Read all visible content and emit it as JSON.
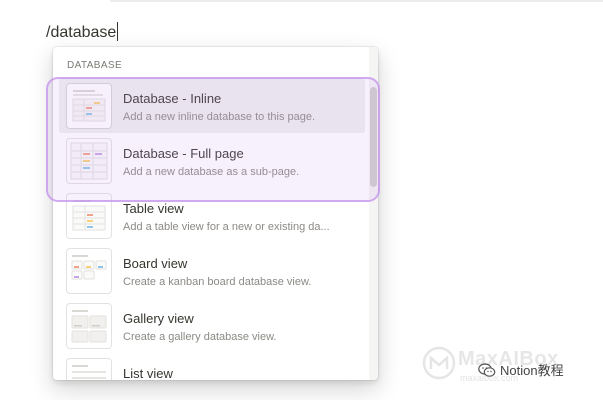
{
  "command": {
    "text": "/database"
  },
  "menu": {
    "header": "DATABASE",
    "items": [
      {
        "title": "Database - Inline",
        "description": "Add a new inline database to this page.",
        "icon": "database-inline-thumbnail-icon",
        "active": true
      },
      {
        "title": "Database - Full page",
        "description": "Add a new database as a sub-page.",
        "icon": "database-full-page-thumbnail-icon",
        "active": false
      },
      {
        "title": "Table view",
        "description": "Add a table view for a new or existing da...",
        "icon": "table-view-thumbnail-icon",
        "active": false
      },
      {
        "title": "Board view",
        "description": "Create a kanban board database view.",
        "icon": "board-view-thumbnail-icon",
        "active": false
      },
      {
        "title": "Gallery view",
        "description": "Create a gallery database view.",
        "icon": "gallery-view-thumbnail-icon",
        "active": false
      },
      {
        "title": "List view",
        "description": "",
        "icon": "list-view-thumbnail-icon",
        "active": false
      }
    ]
  },
  "watermark": {
    "brand": "MaxAIBox",
    "site": "maxaibox.com",
    "wechat_label": "Notion教程"
  },
  "colors": {
    "highlight_border": "#c492ec",
    "active_row": "#ededec",
    "text_primary": "#37352f",
    "text_secondary": "#8c8a85"
  }
}
